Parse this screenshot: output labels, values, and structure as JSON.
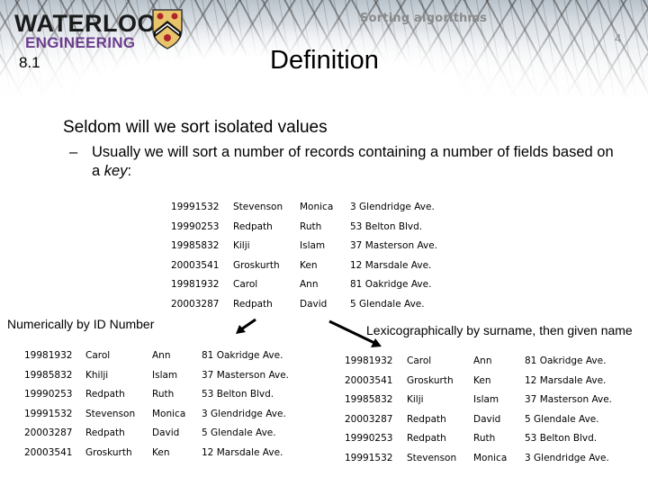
{
  "header": {
    "logo_line1": "WATERLOO",
    "logo_line2": "ENGINEERING",
    "running_title": "Sorting algorithms",
    "page_number": "4",
    "section_number": "8.1",
    "slide_title": "Definition"
  },
  "body": {
    "bullet_1": "Seldom will we sort isolated values",
    "bullet_2_dash": "–",
    "bullet_2_prefix": "Usually we will sort a number of records containing a number of fields based on a ",
    "bullet_2_key": "key",
    "bullet_2_suffix": ":"
  },
  "unsorted_table": {
    "rows": [
      [
        "19991532",
        "Stevenson",
        "Monica",
        "3 Glendridge Ave."
      ],
      [
        "19990253",
        "Redpath",
        "Ruth",
        "53 Belton Blvd."
      ],
      [
        "19985832",
        "Kilji",
        "Islam",
        "37 Masterson Ave."
      ],
      [
        "20003541",
        "Groskurth",
        "Ken",
        "12 Marsdale Ave."
      ],
      [
        "19981932",
        "Carol",
        "Ann",
        "81 Oakridge Ave."
      ],
      [
        "20003287",
        "Redpath",
        "David",
        "5 Glendale Ave."
      ]
    ]
  },
  "numeric_sort": {
    "caption": "Numerically by ID Number",
    "rows": [
      [
        "19981932",
        "Carol",
        "Ann",
        "81 Oakridge Ave."
      ],
      [
        "19985832",
        "Khilji",
        "Islam",
        "37 Masterson Ave."
      ],
      [
        "19990253",
        "Redpath",
        "Ruth",
        "53 Belton Blvd."
      ],
      [
        "19991532",
        "Stevenson",
        "Monica",
        "3 Glendridge Ave."
      ],
      [
        "20003287",
        "Redpath",
        "David",
        "5 Glendale Ave."
      ],
      [
        "20003541",
        "Groskurth",
        "Ken",
        "12 Marsdale Ave."
      ]
    ]
  },
  "lexicographic_sort": {
    "caption": "Lexicographically by surname, then given name",
    "rows": [
      [
        "19981932",
        "Carol",
        "Ann",
        "81 Oakridge Ave."
      ],
      [
        "20003541",
        "Groskurth",
        "Ken",
        "12 Marsdale Ave."
      ],
      [
        "19985832",
        "Kilji",
        "Islam",
        "37 Masterson Ave."
      ],
      [
        "20003287",
        "Redpath",
        "David",
        "5 Glendale Ave."
      ],
      [
        "19990253",
        "Redpath",
        "Ruth",
        "53 Belton Blvd."
      ],
      [
        "19991532",
        "Stevenson",
        "Monica",
        "3 Glendridge Ave."
      ]
    ]
  },
  "colors": {
    "engineering_purple": "#6b3d8e",
    "crest_gold": "#e8c46a",
    "crest_red": "#b0242a",
    "header_gray_text": "#8a8a8a"
  }
}
